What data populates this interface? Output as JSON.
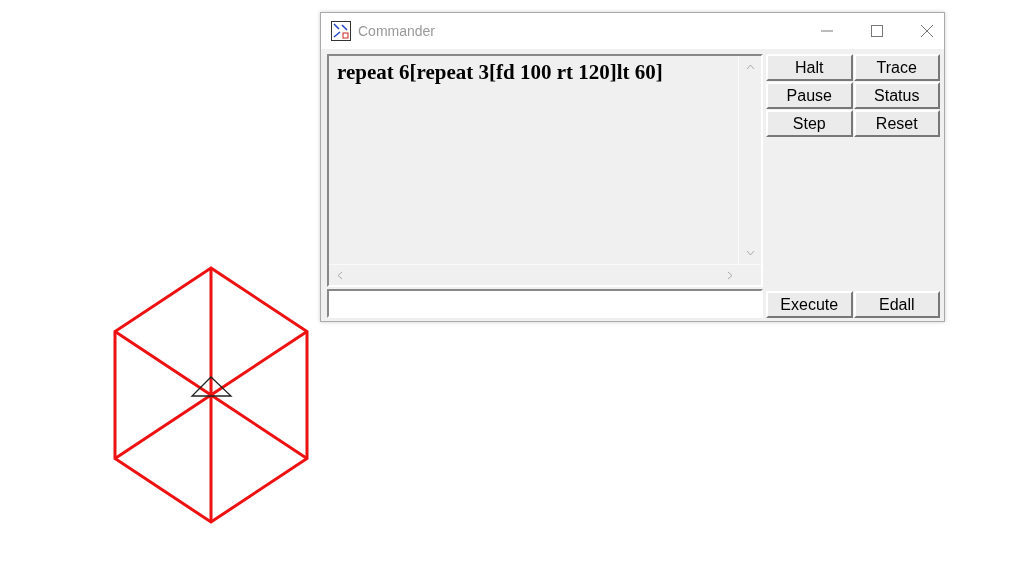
{
  "window": {
    "title": "Commander"
  },
  "editor": {
    "text": "repeat 6[repeat 3[fd 100 rt 120]lt 60]"
  },
  "buttons": [
    {
      "label": "Halt"
    },
    {
      "label": "Trace"
    },
    {
      "label": "Pause"
    },
    {
      "label": "Status"
    },
    {
      "label": "Step"
    },
    {
      "label": "Reset"
    }
  ],
  "bottom_buttons": [
    {
      "label": "Execute"
    },
    {
      "label": "Edall"
    }
  ]
}
